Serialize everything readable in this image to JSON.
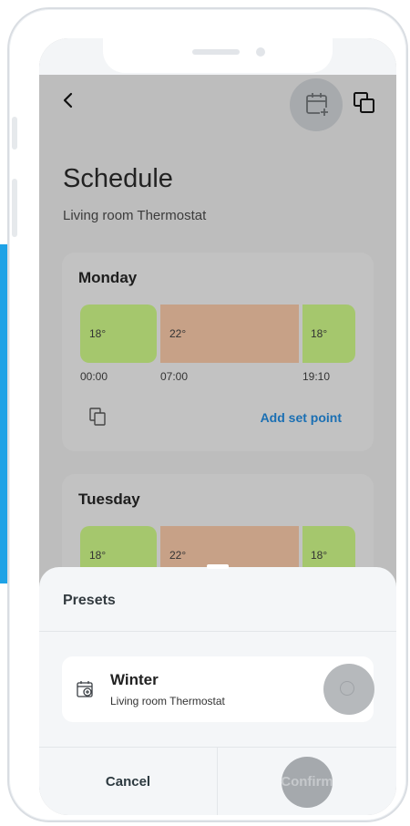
{
  "header": {
    "title": "Schedule",
    "subtitle": "Living room Thermostat"
  },
  "colors": {
    "accent_blue": "#1a6fb3",
    "comfort_green": "#a5c76d",
    "heat_tan": "#c7a187"
  },
  "icons": {
    "back": "chevron-left-icon",
    "add_schedule": "calendar-add-icon",
    "copy": "copy-icon"
  },
  "days": [
    {
      "name": "Monday",
      "segments": [
        "18°",
        "22°",
        "18°"
      ],
      "times": [
        "00:00",
        "07:00",
        "19:10"
      ],
      "add_label": "Add set point"
    },
    {
      "name": "Tuesday",
      "segments": [
        "18°",
        "22°",
        "18°"
      ]
    }
  ],
  "presets_sheet": {
    "title": "Presets",
    "preset": {
      "name": "Winter",
      "device": "Living room Thermostat",
      "selected": false
    },
    "cancel_label": "Cancel",
    "confirm_label": "Confirm"
  }
}
